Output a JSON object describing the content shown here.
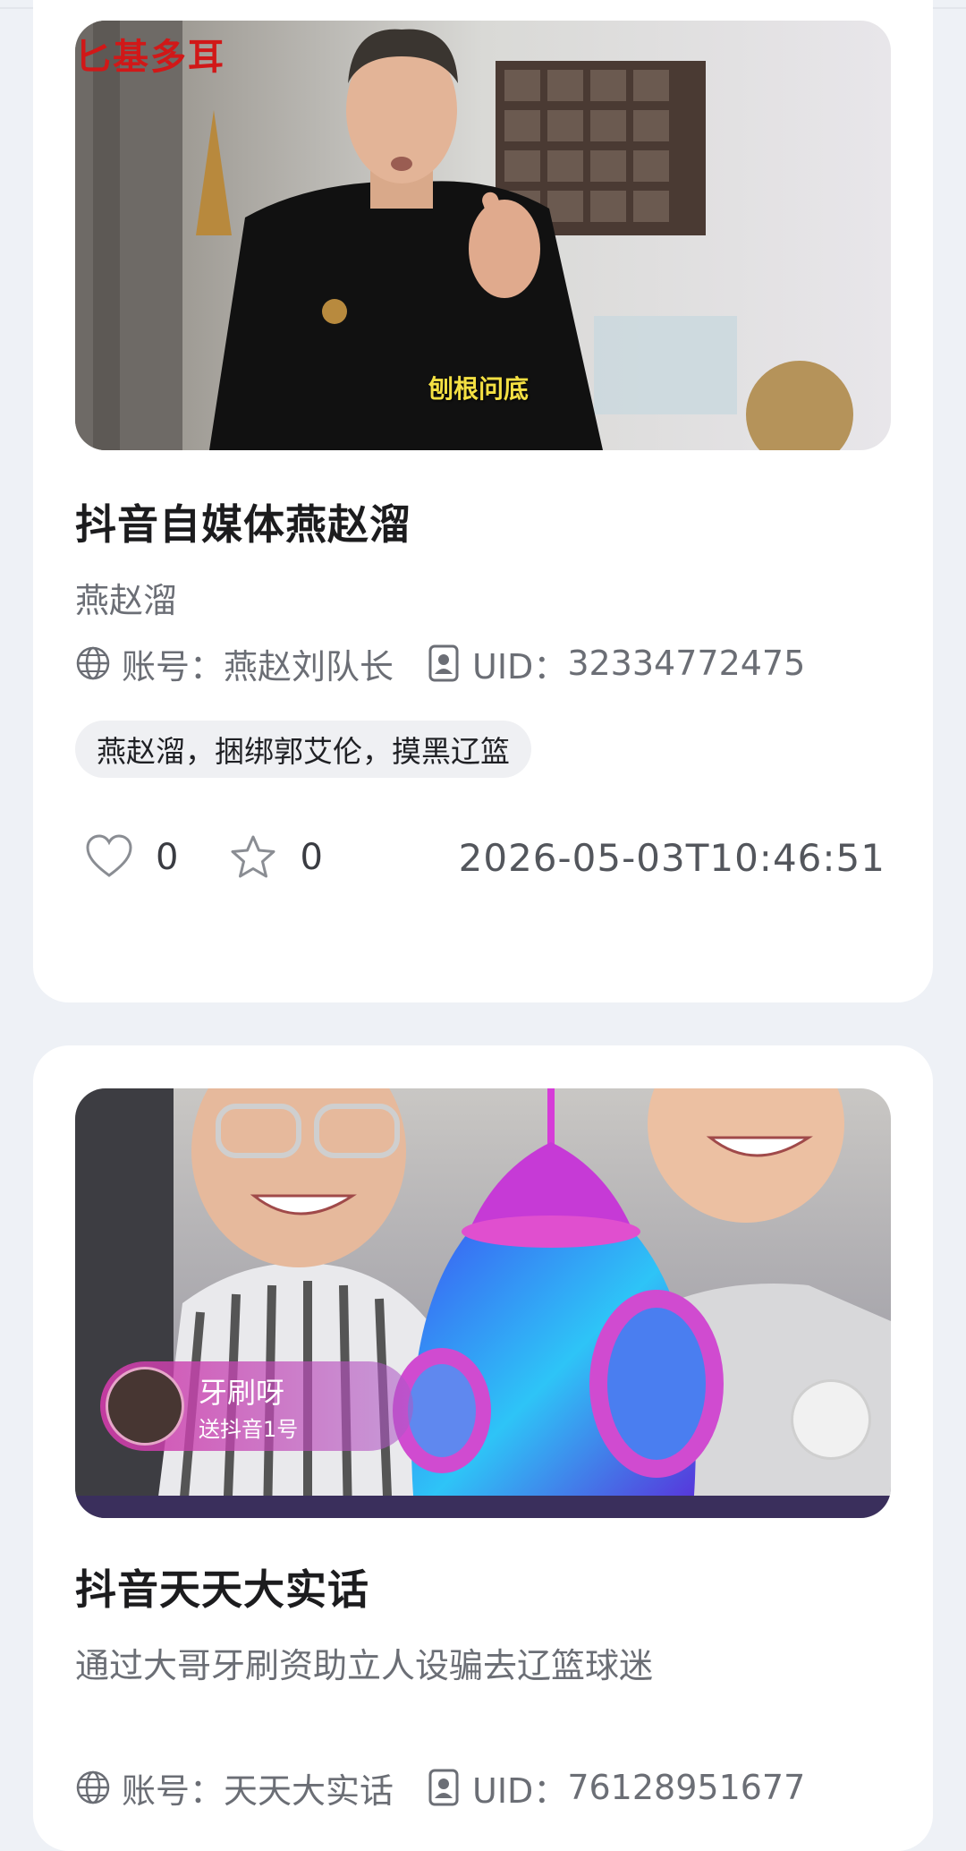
{
  "feed": {
    "items": [
      {
        "thumbnail": {
          "icon": "video-thumbnail-man-in-office",
          "corner_text": "匕基多耳",
          "caption": "刨根问底"
        },
        "title": "抖音自媒体燕赵溜",
        "subtitle": "燕赵溜",
        "account_label": "账号：",
        "account": "燕赵刘队长",
        "uid_label": "UID：",
        "uid": "32334772475",
        "tags": "燕赵溜，捆绑郭艾伦，摸黑辽篮",
        "likes": "0",
        "favorites": "0",
        "date": "2026-05-03T10:46:51"
      },
      {
        "thumbnail": {
          "icon": "video-thumbnail-livestream-rocket-gift",
          "gift_name": "牙刷呀",
          "gift_desc": "送抖音1号"
        },
        "title": "抖音天天大实话",
        "subtitle": "通过大哥牙刷资助立人设骗去辽篮球迷",
        "account_label": "账号：",
        "account": "天天大实话",
        "uid_label": "UID：",
        "uid": "76128951677"
      }
    ]
  },
  "colors": {
    "page_bg": "#eef1f6",
    "card_bg": "#ffffff",
    "title": "#1c1c1e",
    "muted": "#6b6e75",
    "tag_bg": "#eff0f3"
  },
  "icons": {
    "like": "heart-icon",
    "favorite": "star-icon",
    "account": "globe-icon",
    "uid": "id-badge-icon"
  }
}
